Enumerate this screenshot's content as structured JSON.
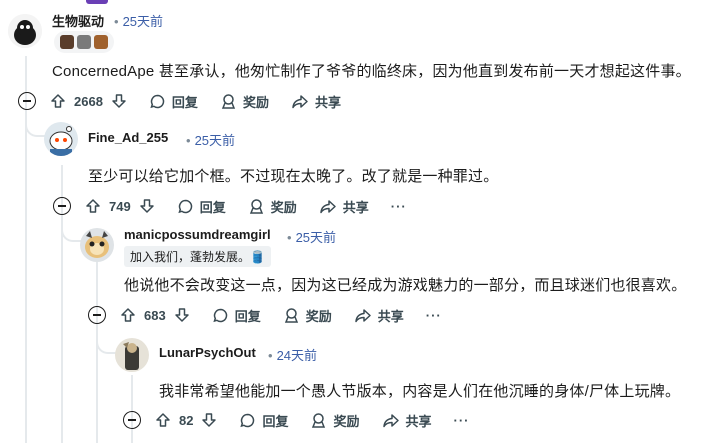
{
  "comments": [
    {
      "author": "生物驱动",
      "time": "25天前",
      "body": "ConcernedApe 甚至承认，他匆忙制作了爷爷的临终床，因为他直到发布前一天才想起这件事。",
      "votes": "2668",
      "reply_label": "回复",
      "award_label": "奖励",
      "share_label": "共享"
    },
    {
      "author": "Fine_Ad_255",
      "time": "25天前",
      "body": "至少可以给它加个框。不过现在太晚了。改了就是一种罪过。",
      "votes": "749",
      "reply_label": "回复",
      "award_label": "奖励",
      "share_label": "共享",
      "more": "···"
    },
    {
      "author": "manicpossumdreamgirl",
      "time": "25天前",
      "flair": "加入我们，蓬勃发展。🛢️",
      "body": "他说他不会改变这一点，因为这已经成为游戏魅力的一部分，而且球迷们也很喜欢。",
      "votes": "683",
      "reply_label": "回复",
      "award_label": "奖励",
      "share_label": "共享",
      "more": "···"
    },
    {
      "author": "LunarPsychOut",
      "time": "24天前",
      "body": "我非常希望他能加一个愚人节版本，内容是人们在他沉睡的身体/尸体上玩牌。",
      "votes": "82",
      "reply_label": "回复",
      "award_label": "奖励",
      "share_label": "共享",
      "more": "···"
    }
  ],
  "colors": {
    "time_link": "#3b5ea7",
    "thread_line": "#e5e9ec",
    "action_text": "#3a4a52"
  }
}
